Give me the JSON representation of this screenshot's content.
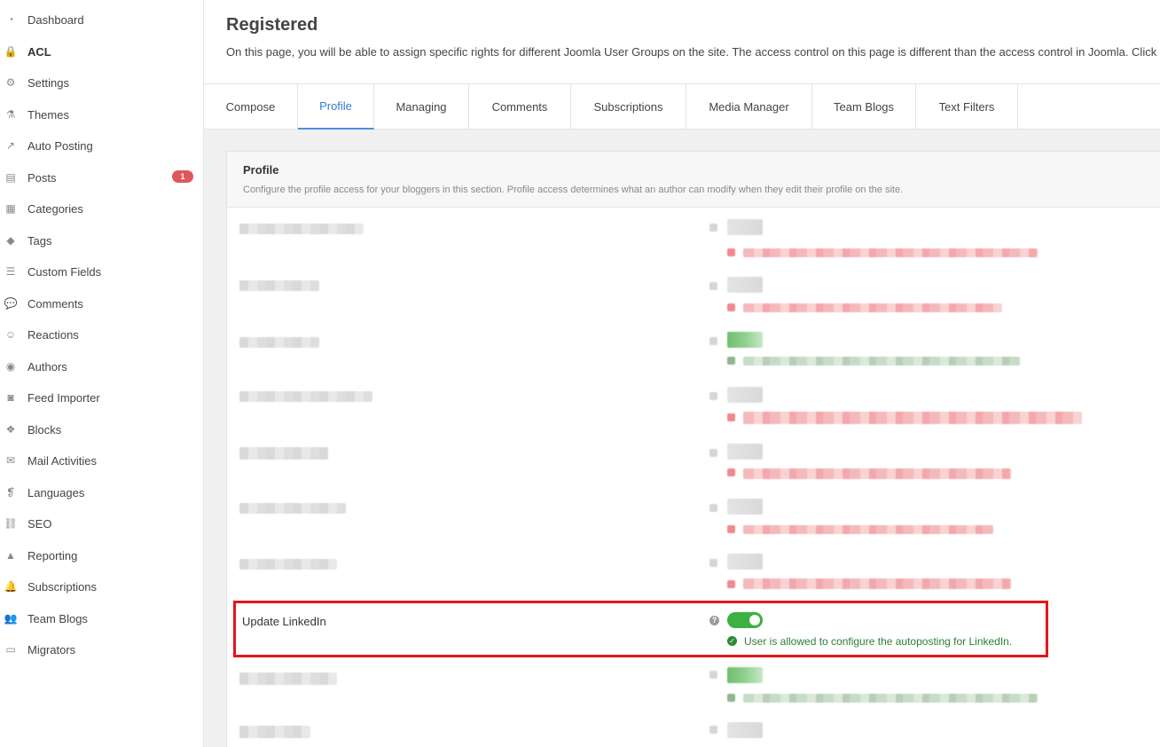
{
  "sidebar": {
    "items": [
      {
        "label": "Dashboard",
        "icon": "dashboard-icon",
        "glyph": "◔"
      },
      {
        "label": "ACL",
        "icon": "lock-icon",
        "glyph": "🔒"
      },
      {
        "label": "Settings",
        "icon": "gear-icon",
        "glyph": "⚙"
      },
      {
        "label": "Themes",
        "icon": "flask-icon",
        "glyph": "⚗"
      },
      {
        "label": "Auto Posting",
        "icon": "share-icon",
        "glyph": "↗"
      },
      {
        "label": "Posts",
        "icon": "document-icon",
        "glyph": "▤",
        "badge": "1"
      },
      {
        "label": "Categories",
        "icon": "archive-icon",
        "glyph": "▦"
      },
      {
        "label": "Tags",
        "icon": "tags-icon",
        "glyph": "◆"
      },
      {
        "label": "Custom Fields",
        "icon": "list-icon",
        "glyph": "☰"
      },
      {
        "label": "Comments",
        "icon": "comments-icon",
        "glyph": "💬"
      },
      {
        "label": "Reactions",
        "icon": "smile-icon",
        "glyph": "☺"
      },
      {
        "label": "Authors",
        "icon": "user-icon",
        "glyph": "◉"
      },
      {
        "label": "Feed Importer",
        "icon": "rss-icon",
        "glyph": "◙"
      },
      {
        "label": "Blocks",
        "icon": "cubes-icon",
        "glyph": "❖"
      },
      {
        "label": "Mail Activities",
        "icon": "envelope-icon",
        "glyph": "✉"
      },
      {
        "label": "Languages",
        "icon": "language-icon",
        "glyph": "❡"
      },
      {
        "label": "SEO",
        "icon": "seo-icon",
        "glyph": "⛓"
      },
      {
        "label": "Reporting",
        "icon": "warning-icon",
        "glyph": "▲"
      },
      {
        "label": "Subscriptions",
        "icon": "bell-icon",
        "glyph": "🔔"
      },
      {
        "label": "Team Blogs",
        "icon": "users-icon",
        "glyph": "👥"
      },
      {
        "label": "Migrators",
        "icon": "laptop-icon",
        "glyph": "▭"
      }
    ],
    "active_index": 1
  },
  "header": {
    "title": "Registered",
    "description": "On this page, you will be able to assign specific rights for different Joomla User Groups on the site. The access control on this page is different than the access control in Joomla. Click"
  },
  "tabs": [
    "Compose",
    "Profile",
    "Managing",
    "Comments",
    "Subscriptions",
    "Media Manager",
    "Team Blogs",
    "Text Filters"
  ],
  "active_tab": "Profile",
  "panel": {
    "title": "Profile",
    "description": "Configure the profile access for your bloggers in this section. Profile access determines what an author can modify when they edit their profile on the site."
  },
  "highlighted_setting": {
    "label": "Update LinkedIn",
    "help_glyph": "?",
    "enabled": true,
    "status_glyph": "✓",
    "status_text": "User is allowed to configure the autoposting for LinkedIn.",
    "status_color": "#2e7d32"
  },
  "colors": {
    "accent": "#4a90e2",
    "toggle_on": "#3cb043",
    "highlight_border": "#e3161c",
    "badge": "#e0575b"
  }
}
